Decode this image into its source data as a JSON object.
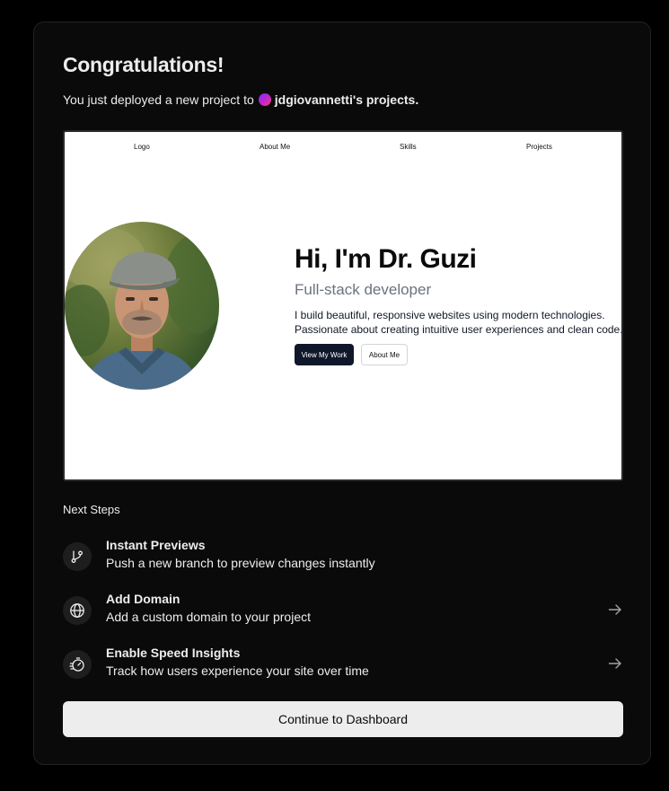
{
  "header": {
    "title": "Congratulations!",
    "subtitle_prefix": "You just deployed a new project to",
    "team_name": "jdgiovannetti's projects."
  },
  "preview": {
    "nav": [
      "Logo",
      "About Me",
      "Skills",
      "Projects"
    ],
    "heading": "Hi, I'm Dr. Guzi",
    "role": "Full-stack developer",
    "bio_line1": "I build beautiful, responsive websites using modern technologies.",
    "bio_line2": "Passionate about creating intuitive user experiences and clean code.",
    "primary_button": "View My Work",
    "secondary_button": "About Me"
  },
  "next_steps": {
    "title": "Next Steps",
    "items": [
      {
        "title": "Instant Previews",
        "description": "Push a new branch to preview changes instantly",
        "icon": "git-branch-icon"
      },
      {
        "title": "Add Domain",
        "description": "Add a custom domain to your project",
        "icon": "globe-icon"
      },
      {
        "title": "Enable Speed Insights",
        "description": "Track how users experience your site over time",
        "icon": "speed-gauge-icon"
      }
    ]
  },
  "footer": {
    "continue_label": "Continue to Dashboard"
  },
  "colors": {
    "background": "#000000",
    "card": "#0a0a0a",
    "text": "#ededed",
    "button": "#ededed",
    "preview_primary_button": "#0f172a"
  }
}
